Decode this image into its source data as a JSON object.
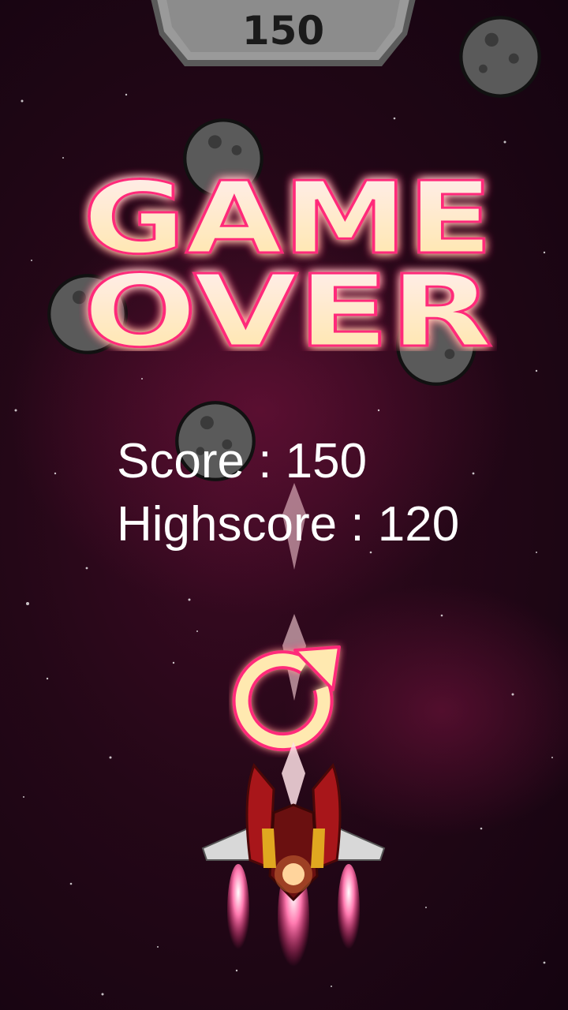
{
  "hud": {
    "score": "150"
  },
  "title": {
    "line1": "GAME",
    "line2": "OVER"
  },
  "results": {
    "score_label": "Score : 150",
    "highscore_label": "Highscore : 120",
    "score": 150,
    "highscore": 120
  },
  "controls": {
    "restart_icon": "restart-icon"
  },
  "colors": {
    "glow": "#ff2a7a",
    "title_fill_top": "#ffe8f0",
    "title_fill_bottom": "#ffe9a8",
    "plate": "#8e8e8e",
    "background": "#240717"
  }
}
